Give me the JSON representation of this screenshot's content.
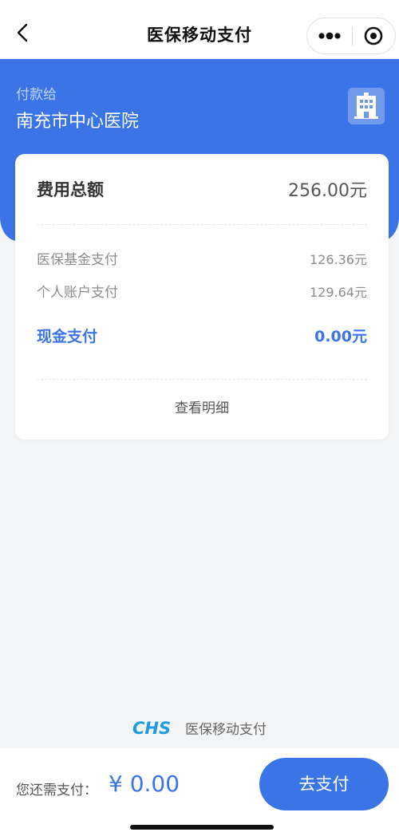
{
  "navbar": {
    "title": "医保移动支付",
    "back_icon": "back-chevron-icon",
    "more_icon": "more-dots-icon",
    "close_icon": "target-close-icon"
  },
  "header": {
    "payee_label": "付款给",
    "payee_name": "南充市中心医院",
    "hospital_icon": "hospital-building-icon"
  },
  "summary": {
    "total_label": "费用总额",
    "total_value": "256.00元",
    "breakdown": [
      {
        "label": "医保基金支付",
        "value": "126.36元"
      },
      {
        "label": "个人账户支付",
        "value": "129.64元"
      }
    ],
    "cash_label": "现金支付",
    "cash_value": "0.00元",
    "detail_link": "查看明细"
  },
  "brand": {
    "logo_text": "CHS",
    "name": "医保移动支付"
  },
  "footer": {
    "due_label": "您还需支付：",
    "due_amount": "¥ 0.00",
    "pay_button": "去支付"
  },
  "colors": {
    "accent": "#3b74e6",
    "background": "#f4f5f7",
    "card": "#ffffff"
  }
}
